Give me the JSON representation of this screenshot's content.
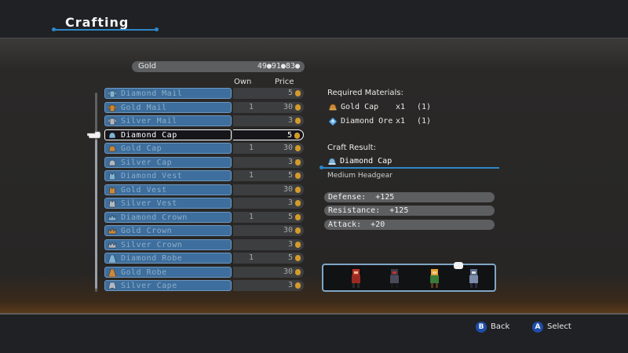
{
  "header": {
    "title": "Crafting"
  },
  "gold": {
    "label": "Gold",
    "value": "49●91●83●"
  },
  "columns": {
    "own": "Own",
    "price": "Price"
  },
  "items": [
    {
      "name": "Diamond Mail",
      "own": "",
      "price": "5",
      "icon": "mail-icon",
      "icon_color": "#7fb3d6"
    },
    {
      "name": "Gold Mail",
      "own": "1",
      "price": "30",
      "icon": "mail-icon",
      "icon_color": "#c9883a"
    },
    {
      "name": "Silver Mail",
      "own": "",
      "price": "3",
      "icon": "mail-icon",
      "icon_color": "#b0b8c4"
    },
    {
      "name": "Diamond Cap",
      "own": "",
      "price": "5",
      "icon": "cap-icon",
      "icon_color": "#7fb3d6",
      "selected": true
    },
    {
      "name": "Gold Cap",
      "own": "1",
      "price": "30",
      "icon": "cap-icon",
      "icon_color": "#c9883a"
    },
    {
      "name": "Silver Cap",
      "own": "",
      "price": "3",
      "icon": "cap-icon",
      "icon_color": "#b0b8c4"
    },
    {
      "name": "Diamond Vest",
      "own": "1",
      "price": "5",
      "icon": "vest-icon",
      "icon_color": "#7fb3d6"
    },
    {
      "name": "Gold Vest",
      "own": "",
      "price": "30",
      "icon": "vest-icon",
      "icon_color": "#c9883a"
    },
    {
      "name": "Silver Vest",
      "own": "",
      "price": "3",
      "icon": "vest-icon",
      "icon_color": "#b0b8c4"
    },
    {
      "name": "Diamond Crown",
      "own": "1",
      "price": "5",
      "icon": "crown-icon",
      "icon_color": "#7fb3d6"
    },
    {
      "name": "Gold Crown",
      "own": "",
      "price": "30",
      "icon": "crown-icon",
      "icon_color": "#c9883a"
    },
    {
      "name": "Silver Crown",
      "own": "",
      "price": "3",
      "icon": "crown-icon",
      "icon_color": "#b0b8c4"
    },
    {
      "name": "Diamond Robe",
      "own": "1",
      "price": "5",
      "icon": "robe-icon",
      "icon_color": "#7fb3d6"
    },
    {
      "name": "Gold Robe",
      "own": "",
      "price": "30",
      "icon": "robe-icon",
      "icon_color": "#c9883a"
    },
    {
      "name": "Silver Cape",
      "own": "",
      "price": "3",
      "icon": "cape-icon",
      "icon_color": "#b0b8c4"
    }
  ],
  "required": {
    "title": "Required Materials:",
    "materials": [
      {
        "name": "Gold Cap",
        "qty": "x1",
        "owned": "(1)"
      },
      {
        "name": "Diamond Ore",
        "qty": "x1",
        "owned": "(1)"
      }
    ]
  },
  "result": {
    "title": "Craft Result:",
    "name": "Diamond Cap",
    "type": "Medium Headgear",
    "stats": [
      "Defense:  +125",
      "Resistance:  +125",
      "Attack:  +20"
    ]
  },
  "buttons": {
    "back": {
      "key": "B",
      "label": "Back"
    },
    "select": {
      "key": "A",
      "label": "Select"
    }
  },
  "colors": {
    "accent": "#2e87c8",
    "row": "#3d6e9d",
    "gold_coin": "#d49a2a"
  }
}
